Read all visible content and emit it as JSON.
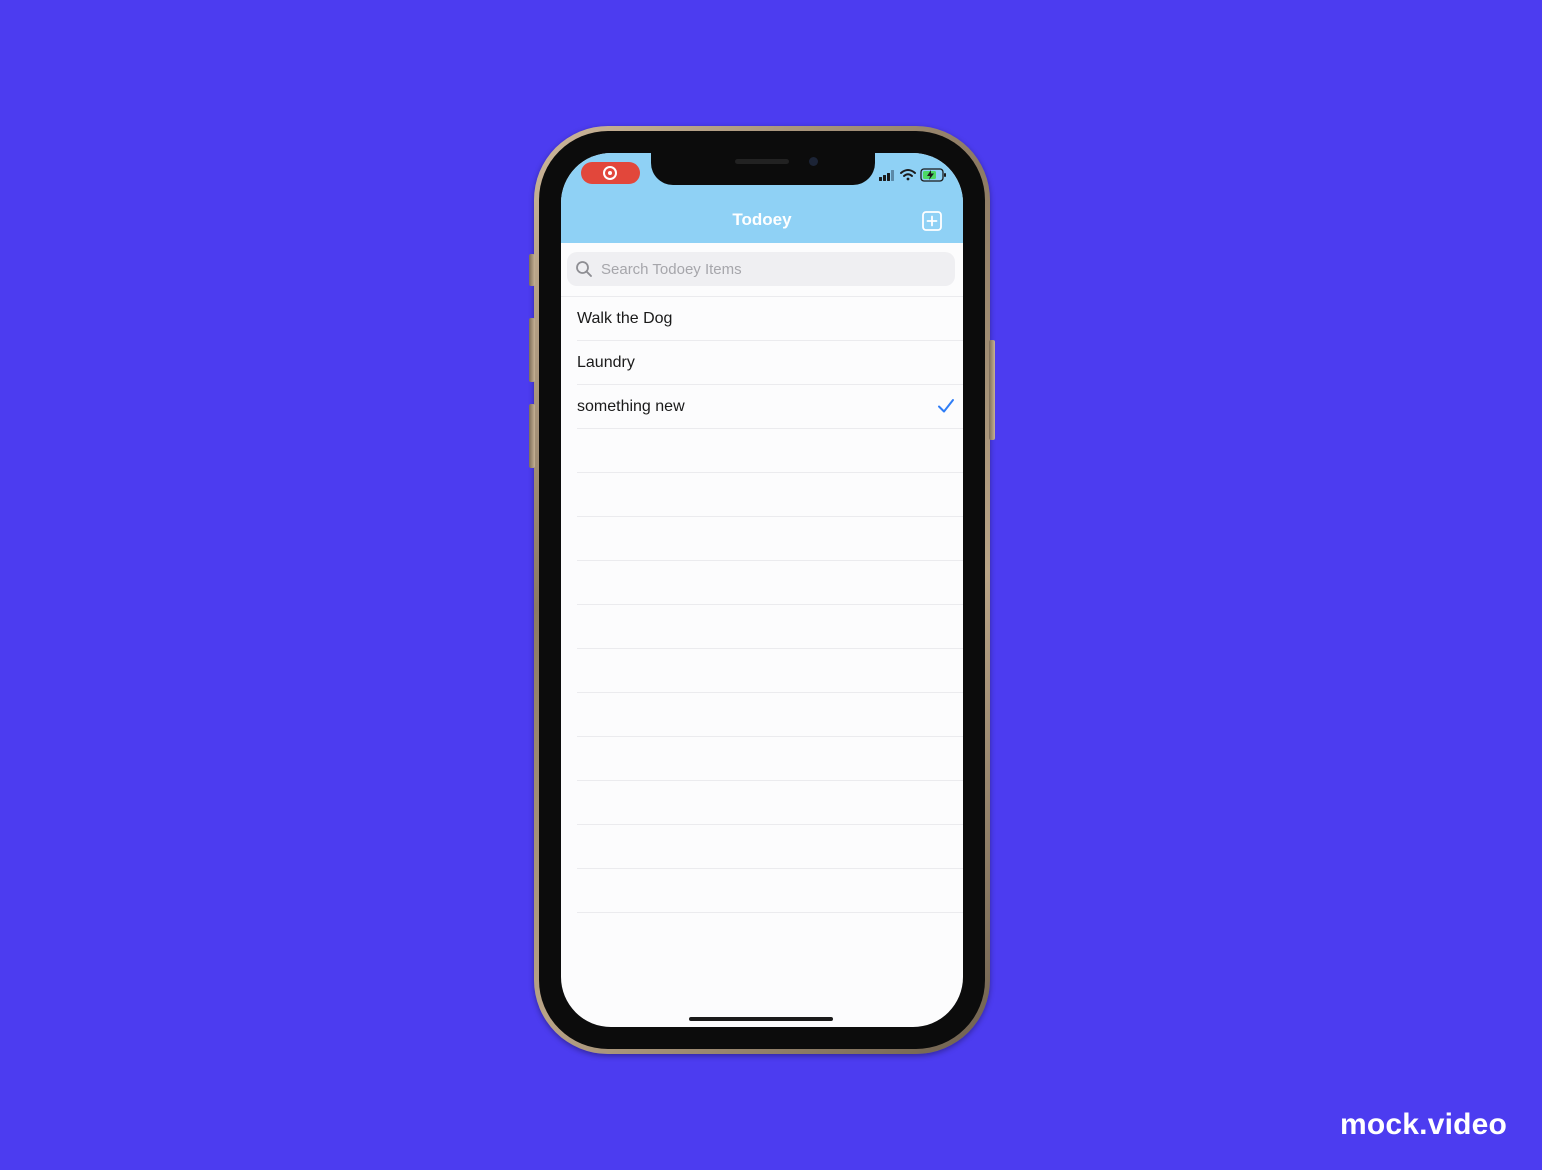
{
  "app": {
    "title": "Todoey"
  },
  "status_bar": {
    "recording_indicator": "screen-recording-icon",
    "icons": [
      "signal-icon",
      "wifi-icon",
      "battery-charging-icon"
    ]
  },
  "search": {
    "placeholder": "Search Todoey Items",
    "value": ""
  },
  "items": [
    {
      "label": "Walk the Dog",
      "done": false
    },
    {
      "label": "Laundry",
      "done": false
    },
    {
      "label": "something new",
      "done": true
    }
  ],
  "colors": {
    "background": "#4c3cf0",
    "nav_bar": "#8fd1f5",
    "checkmark": "#2f7df6",
    "record_pill": "#e2473b"
  },
  "watermark": "mock.video"
}
